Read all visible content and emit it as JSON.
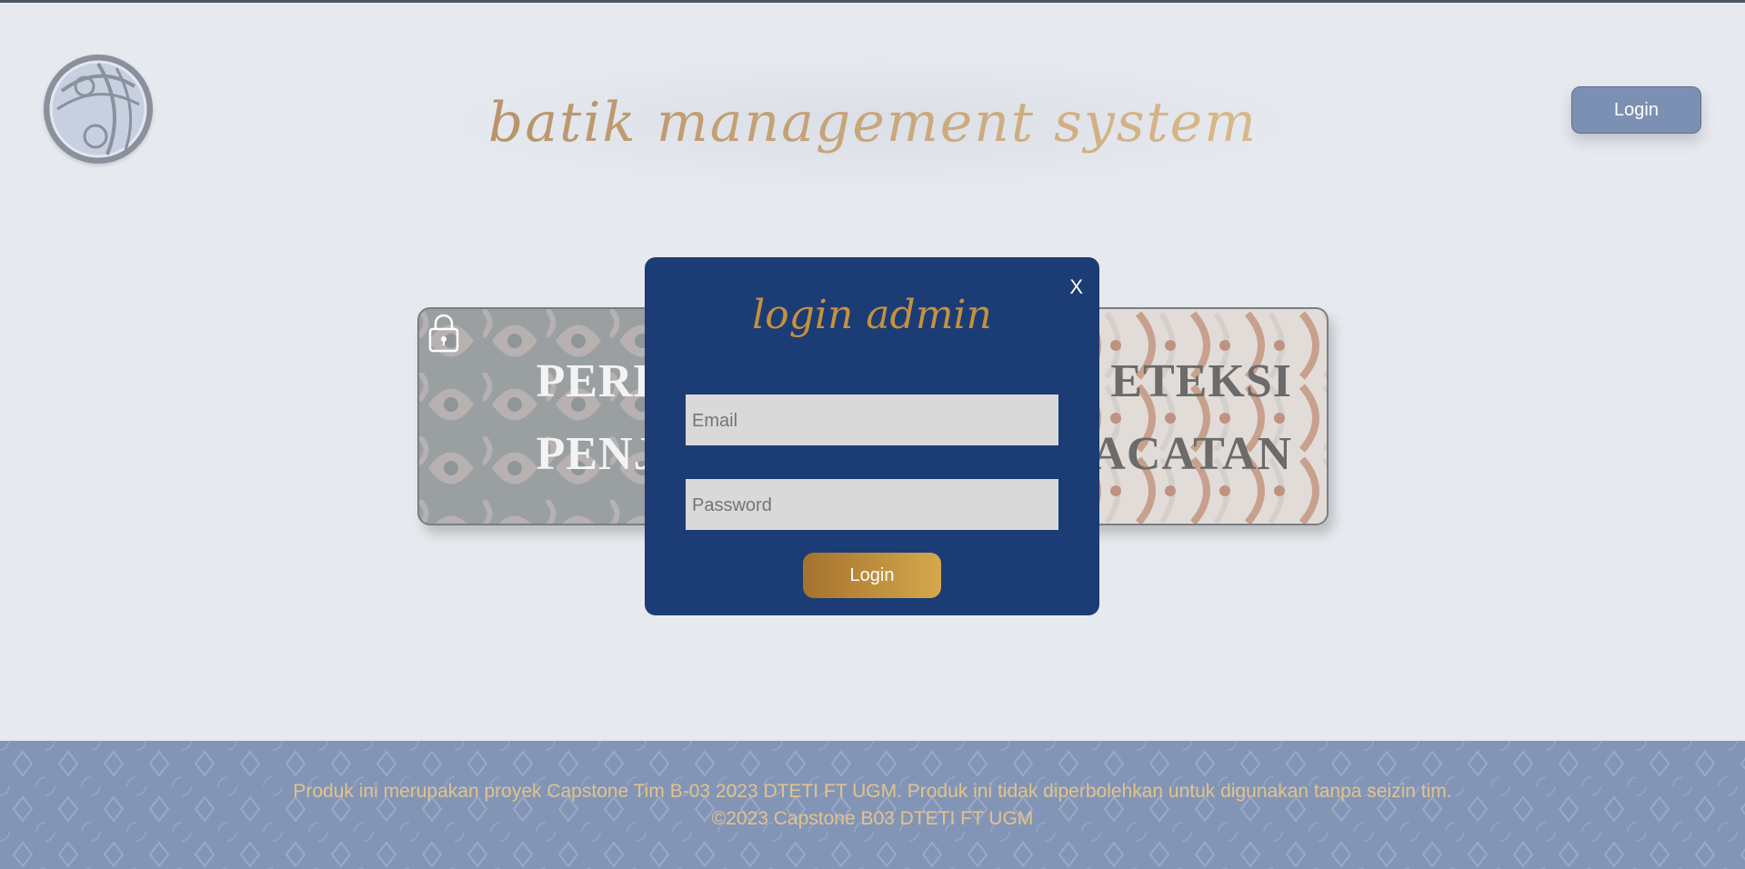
{
  "header": {
    "title": "batik management system",
    "login_label": "Login"
  },
  "cards": {
    "left": {
      "line1": "PERKIRA",
      "line2": "PENJUAL"
    },
    "right": {
      "line1": "ETEKSI",
      "line2": "ACATAN"
    }
  },
  "modal": {
    "title": "login admin",
    "close_label": "X",
    "email_placeholder": "Email",
    "password_placeholder": "Password",
    "login_label": "Login"
  },
  "footer": {
    "line1": "Produk ini merupakan proyek Capstone Tim B-03 2023 DTETI FT UGM. Produk ini tidak diperbolehkan untuk digunakan tanpa seizin tim.",
    "line2": "©2023 Capstone B03 DTETI FT UGM"
  },
  "colors": {
    "page_bg": "#e6e9ee",
    "modal_bg": "#1b3c75",
    "accent_gold": "#c4913f",
    "header_button": "#7b90b3",
    "footer_bg": "#8395b6"
  }
}
